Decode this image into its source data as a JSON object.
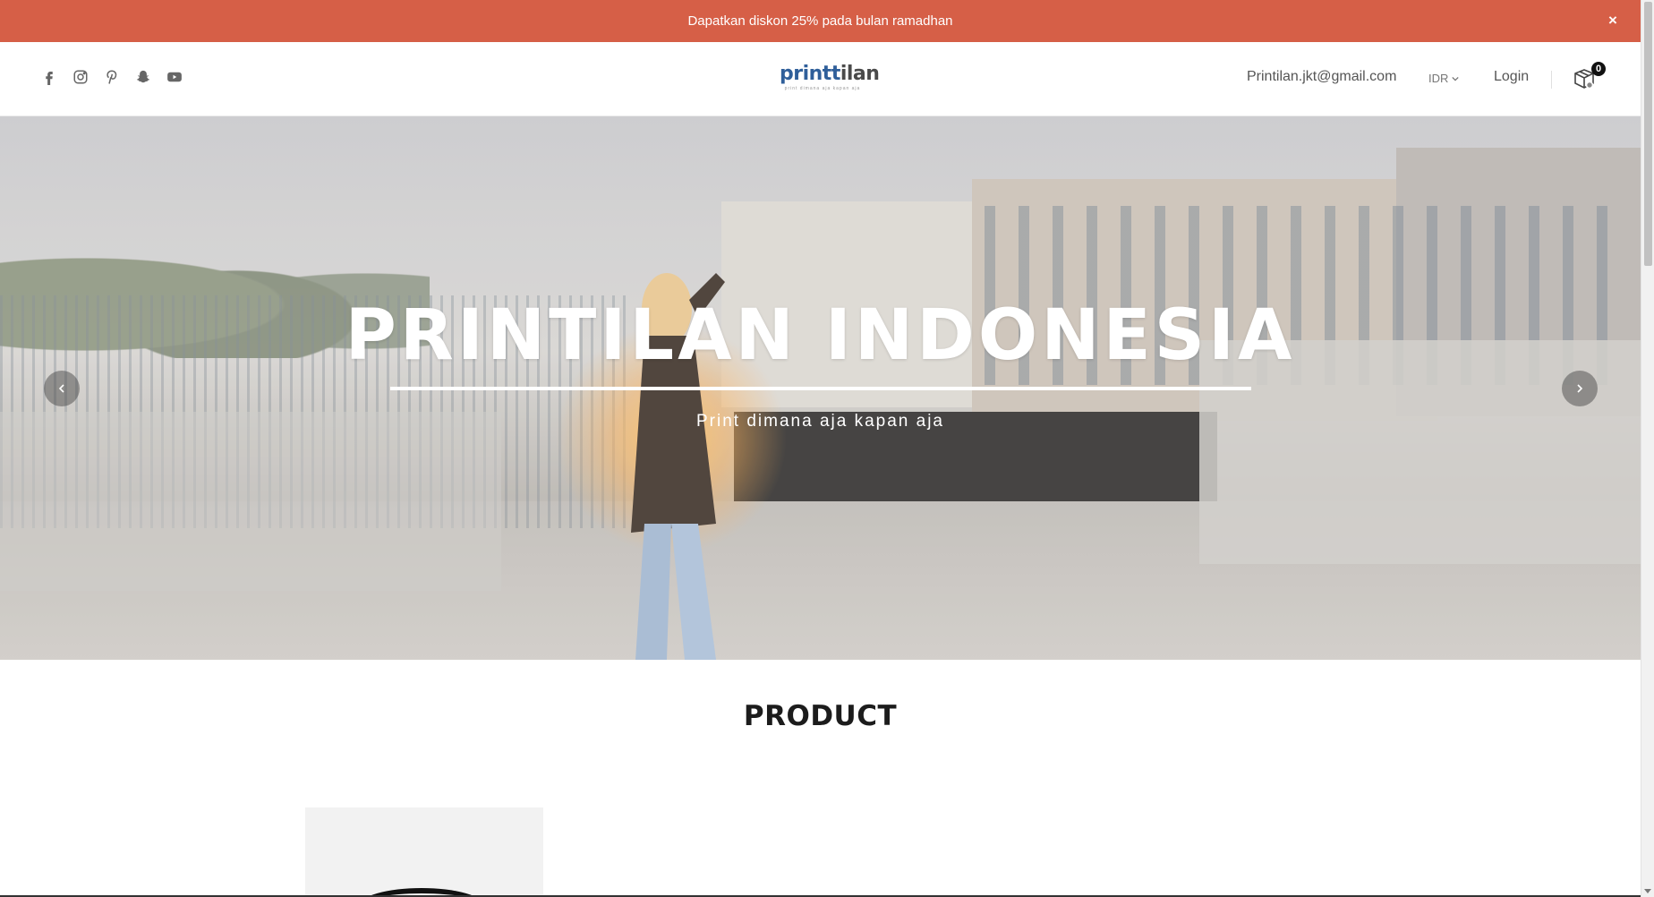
{
  "announcement": {
    "text": "Dapatkan diskon 25% pada bulan ramadhan",
    "close_icon": "×"
  },
  "header": {
    "social_icons": [
      "facebook-icon",
      "instagram-icon",
      "pinterest-icon",
      "snapchat-icon",
      "youtube-icon"
    ],
    "logo": {
      "part1": "print",
      "part2": "ilan",
      "accent": "t",
      "tagline": "print dimana aja kapan aja"
    },
    "email": "Printilan.jkt@gmail.com",
    "currency": "IDR",
    "login": "Login",
    "cart_count": "0"
  },
  "hero": {
    "title": "PRINTILAN INDONESIA",
    "subtitle": "Print dimana aja kapan aja"
  },
  "products": {
    "section_title": "PRODUCT"
  },
  "colors": {
    "announcement_bg": "#d65f47",
    "logo_blue": "#2f5f9a"
  }
}
